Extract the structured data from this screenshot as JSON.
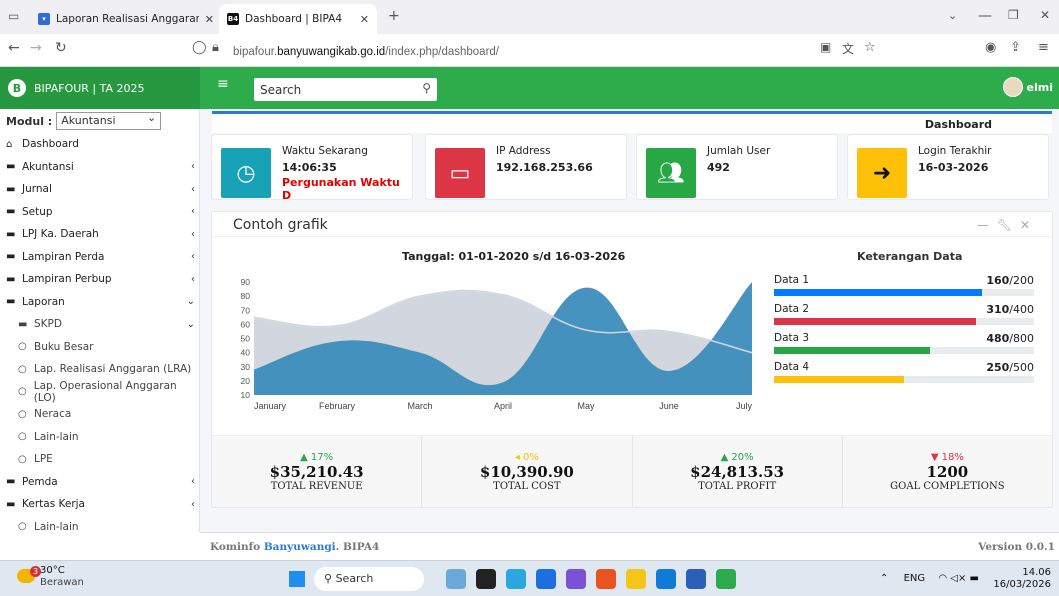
{
  "browser": {
    "tabs": [
      {
        "title": "Laporan Realisasi Anggaran - Al",
        "active": false
      },
      {
        "title": "Dashboard | BIPA4",
        "active": true
      }
    ],
    "url_prefix": "bipafour.",
    "url_domain": "banyuwangikab.go.id",
    "url_path": "/index.php/dashboard/"
  },
  "app": {
    "brand": "BIPAFOUR | TA 2025",
    "search_placeholder": "Search",
    "user": "elmi"
  },
  "sidebar": {
    "modul_label": "Modul :",
    "modul_value": "Akuntansi",
    "items": [
      {
        "label": "Dashboard",
        "icon": "home-icon",
        "arrow": ""
      },
      {
        "label": "Akuntansi",
        "icon": "folder-icon",
        "arrow": "‹"
      },
      {
        "label": "Jurnal",
        "icon": "folder-icon",
        "arrow": "‹"
      },
      {
        "label": "Setup",
        "icon": "folder-icon",
        "arrow": "‹"
      },
      {
        "label": "LPJ Ka. Daerah",
        "icon": "folder-icon",
        "arrow": "‹"
      },
      {
        "label": "Lampiran Perda",
        "icon": "folder-icon",
        "arrow": "‹"
      },
      {
        "label": "Lampiran Perbup",
        "icon": "folder-icon",
        "arrow": "‹"
      },
      {
        "label": "Laporan",
        "icon": "folder-icon",
        "arrow": "⌄"
      },
      {
        "label": "SKPD",
        "icon": "folder-icon",
        "arrow": "⌄"
      },
      {
        "label": "Buku Besar",
        "icon": "circle-icon",
        "arrow": ""
      },
      {
        "label": "Lap. Realisasi Anggaran (LRA)",
        "icon": "circle-icon",
        "arrow": ""
      },
      {
        "label": "Lap. Operasional Anggaran (LO)",
        "icon": "circle-icon",
        "arrow": ""
      },
      {
        "label": "Neraca",
        "icon": "circle-icon",
        "arrow": ""
      },
      {
        "label": "Lain-lain",
        "icon": "circle-icon",
        "arrow": ""
      },
      {
        "label": "LPE",
        "icon": "circle-icon",
        "arrow": ""
      },
      {
        "label": "Pemda",
        "icon": "folder-icon",
        "arrow": "‹"
      },
      {
        "label": "Kertas Kerja",
        "icon": "folder-icon",
        "arrow": "‹"
      },
      {
        "label": "Lain-lain",
        "icon": "circle-icon",
        "arrow": ""
      }
    ]
  },
  "breadcrumb": "Dashboard",
  "info_boxes": [
    {
      "label": "Waktu Sekarang",
      "value": "14:06:35",
      "extra": "Pergunakan Waktu D",
      "color": "#17a2b8",
      "icon": "clock-icon"
    },
    {
      "label": "IP Address",
      "value": "192.168.253.66",
      "extra": "",
      "color": "#dc3545",
      "icon": "monitor-icon"
    },
    {
      "label": "Jumlah User",
      "value": "492",
      "extra": "",
      "color": "#28a745",
      "icon": "users-icon"
    },
    {
      "label": "Login Terakhir",
      "value": "16-03-2026",
      "extra": "",
      "color": "#ffc107",
      "icon": "login-icon"
    }
  ],
  "chart_box": {
    "title": "Contoh grafik",
    "date_range": "Tanggal: 01-01-2020 s/d 16-03-2026",
    "legend_title": "Keterangan Data"
  },
  "chart_data": {
    "type": "area",
    "categories": [
      "January",
      "February",
      "March",
      "April",
      "May",
      "June",
      "July"
    ],
    "ylim": [
      10,
      90
    ],
    "yticks": [
      10,
      20,
      30,
      40,
      50,
      60,
      70,
      80,
      90
    ],
    "series": [
      {
        "values": [
          65,
          59,
          80,
          81,
          56,
          55,
          40
        ],
        "color": "#d2d6de"
      },
      {
        "values": [
          28,
          48,
          40,
          19,
          86,
          27,
          90
        ],
        "color": "#3c8dbc"
      }
    ]
  },
  "progress": [
    {
      "label": "Data 1",
      "num": "160",
      "den": "/200",
      "fraction": 0.8,
      "color": "#007bff"
    },
    {
      "label": "Data 2",
      "num": "310",
      "den": "/400",
      "fraction": 0.775,
      "color": "#dc3545"
    },
    {
      "label": "Data 3",
      "num": "480",
      "den": "/800",
      "fraction": 0.6,
      "color": "#28a745"
    },
    {
      "label": "Data 4",
      "num": "250",
      "den": "/500",
      "fraction": 0.5,
      "color": "#ffc107"
    }
  ],
  "stats": [
    {
      "pct": "▲ 17%",
      "value": "$35,210.43",
      "label": "TOTAL REVENUE",
      "color": "#28a745"
    },
    {
      "pct": "◂ 0%",
      "value": "$10,390.90",
      "label": "TOTAL COST",
      "color": "#ffc107"
    },
    {
      "pct": "▲ 20%",
      "value": "$24,813.53",
      "label": "TOTAL PROFIT",
      "color": "#28a745"
    },
    {
      "pct": "▼ 18%",
      "value": "1200",
      "label": "GOAL COMPLETIONS",
      "color": "#dc3545"
    }
  ],
  "footer": {
    "prefix": "Kominfo",
    "org": "Banyuwangi",
    "suffix": ". BIPA4",
    "version": "Version 0.0.1"
  },
  "taskbar": {
    "temp": "30°C",
    "weather": "Berawan",
    "badge": "3",
    "search": "Search",
    "lang": "ENG",
    "time": "14.06",
    "date": "16/03/2026"
  }
}
